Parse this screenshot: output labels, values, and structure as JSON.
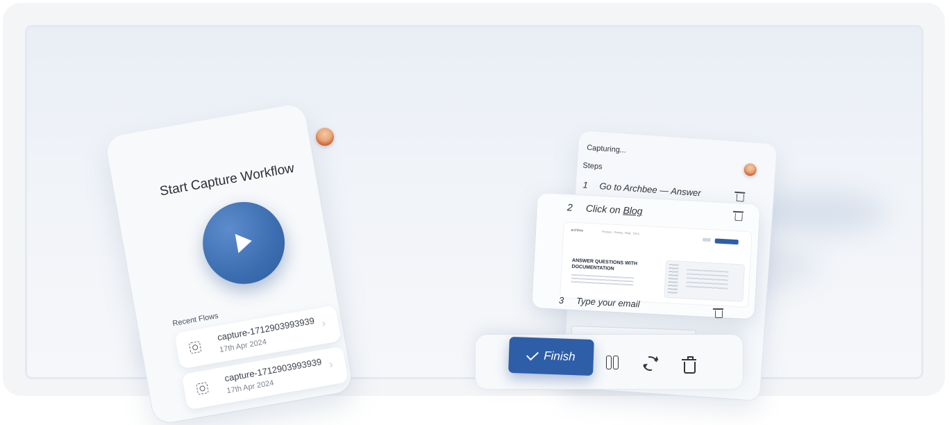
{
  "start_screen": {
    "title": "Start Capture Workflow",
    "recent_label": "Recent Flows",
    "recent_flows": [
      {
        "name": "capture-1712903993939",
        "date": "17th Apr 2024"
      },
      {
        "name": "capture-1712903993939",
        "date": "17th Apr 2024"
      }
    ]
  },
  "capture_panel": {
    "status": "Capturing...",
    "steps_label": "Steps",
    "steps": [
      {
        "number": "1",
        "text": "Go to Archbee — Answer"
      },
      {
        "number": "2",
        "text_prefix": "Click on ",
        "link": "Blog"
      },
      {
        "number": "3",
        "text": "Type your email"
      }
    ],
    "preview": {
      "logo": "archbee",
      "nav": "Product · Pricing · Blog · Docs",
      "heading": "ANSWER QUESTIONS WITH DOCUMENTATION"
    }
  },
  "toolbar": {
    "finish_label": "Finish",
    "icons": [
      "check-icon",
      "pause-icon",
      "refresh-icon",
      "trash-icon"
    ]
  },
  "colors": {
    "accent": "#2e5ea8",
    "background": "#eef2f7"
  }
}
